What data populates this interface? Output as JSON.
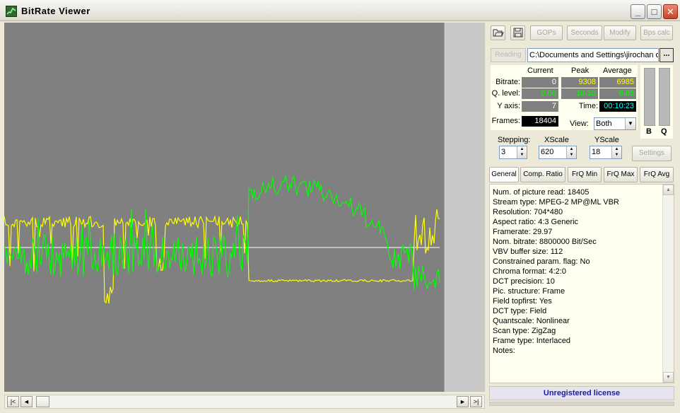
{
  "window": {
    "title": "BitRate  Viewer",
    "min_glyph": "_",
    "max_glyph": "□",
    "close_glyph": "✕"
  },
  "toolbar": {
    "open_icon": "folder-open-icon",
    "save_icon": "floppy-disk-icon",
    "gops": "GOPs",
    "seconds": "Seconds",
    "modify": "Modify",
    "bps_calc": "Bps calc"
  },
  "file": {
    "reading_label": "Reading",
    "path": "C:\\Documents and Settings\\jirochan o",
    "browse_glyph": "..."
  },
  "stats": {
    "headers": {
      "current": "Current",
      "peak": "Peak",
      "average": "Average"
    },
    "bitrate_label": "Bitrate:",
    "qlevel_label": "Q. level:",
    "yaxis_label": "Y axis:",
    "time_label": "Time:",
    "frames_label": "Frames:",
    "bitrate_current": "0",
    "bitrate_peak": "9308",
    "bitrate_average": "6985",
    "qlevel_current": "0.00",
    "qlevel_peak": "10.10",
    "qlevel_average": "6.85",
    "yaxis_value": "7",
    "time_value": "00:10:23",
    "frames_value": "18404"
  },
  "meters": {
    "b_label": "B",
    "q_label": "Q"
  },
  "view": {
    "label": "View:",
    "selected": "Both"
  },
  "controls": {
    "stepping_label": "Stepping:",
    "stepping_value": "3",
    "xscale_label": "XScale",
    "xscale_value": "620",
    "yscale_label": "YScale",
    "yscale_value": "18",
    "settings_label": "Settings"
  },
  "tabs": [
    "General",
    "Comp. Ratio",
    "FrQ Min",
    "FrQ Max",
    "FrQ Avg"
  ],
  "info_lines": [
    "Num. of picture read: 18405",
    "Stream type: MPEG-2  MP@ML  VBR",
    "Resolution: 704*480",
    "Aspect ratio: 4:3 Generic",
    "Framerate: 29.97",
    "Nom. bitrate: 8800000 Bit/Sec",
    "VBV buffer size: 112",
    "Constrained param. flag: No",
    "Chroma format: 4:2:0",
    "DCT precision: 10",
    "Pic. structure: Frame",
    "Field topfirst: Yes",
    "DCT type: Field",
    "Quantscale: Nonlinear",
    "Scan type: ZigZag",
    "Frame type: Interlaced",
    "Notes:"
  ],
  "license": "Unregistered license",
  "scroll": {
    "first": "|<",
    "prev": "◄",
    "next": "►",
    "last": ">|"
  },
  "colors": {
    "bitrate_line": "#00ff00",
    "q_line": "#ffff00",
    "average_line": "#ffffff",
    "graph_bg": "#808080"
  }
}
